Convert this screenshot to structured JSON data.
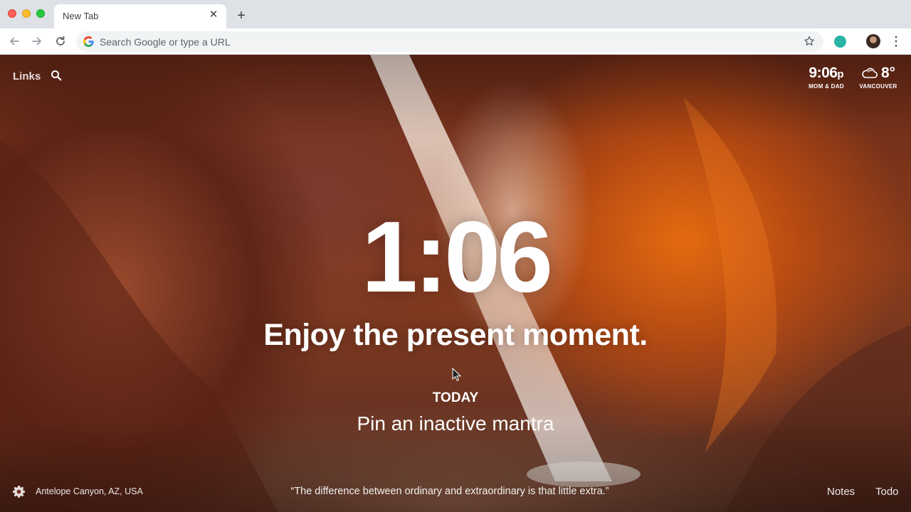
{
  "browser": {
    "tab": {
      "title": "New Tab",
      "close_glyph": "✕"
    },
    "new_tab_glyph": "+",
    "omnibox": {
      "placeholder": "Search Google or type a URL"
    },
    "menu_glyph": "⋮",
    "icons": [
      "back-icon",
      "forward-icon",
      "reload-icon",
      "google-icon",
      "star-icon",
      "extension-icon",
      "profile-avatar",
      "menu-icon"
    ]
  },
  "momentum": {
    "links_label": "Links",
    "world_clock": {
      "time": "9:06",
      "ampm": "p",
      "label": "MOM & DAD"
    },
    "weather": {
      "temperature": "8°",
      "location": "VANCOUVER",
      "icon": "cloud-icon"
    },
    "clock": "1:06",
    "mantra": "Enjoy the present moment.",
    "today_label": "TODAY",
    "focus_text": "Pin an inactive mantra",
    "photo_location": "Antelope Canyon, AZ, USA",
    "quote": "“The difference between ordinary and extraordinary is that little extra.”",
    "notes_label": "Notes",
    "todo_label": "Todo"
  },
  "colors": {
    "tabstrip": "#dee1e6",
    "omnibox": "#f1f3f4",
    "extension": "#2bb3a6",
    "canyon_orange": "#e36a10",
    "canyon_dark": "#6a2a18"
  }
}
